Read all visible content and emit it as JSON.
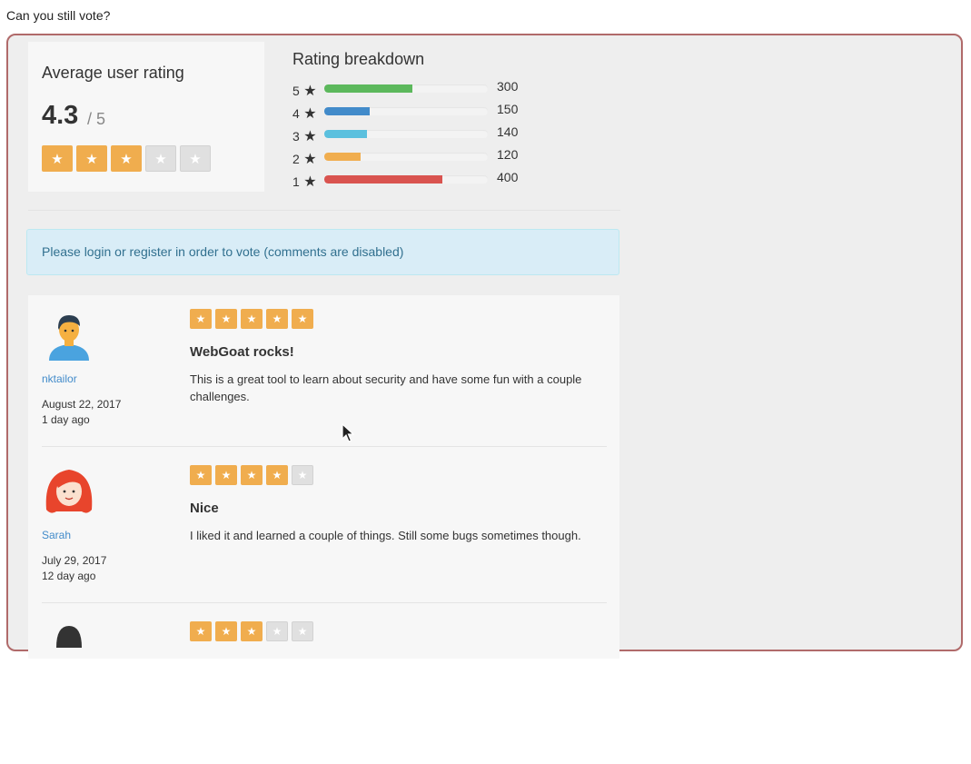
{
  "page": {
    "heading": "Can you still vote?"
  },
  "average": {
    "title": "Average user rating",
    "score": "4.3",
    "out_of": "/ 5",
    "stars_filled": 3,
    "stars_total": 5
  },
  "breakdown": {
    "title": "Rating breakdown",
    "rows": [
      {
        "stars": "5",
        "count": "300",
        "fraction": 0.54,
        "color": "#5cb85c"
      },
      {
        "stars": "4",
        "count": "150",
        "fraction": 0.28,
        "color": "#428bca"
      },
      {
        "stars": "3",
        "count": "140",
        "fraction": 0.26,
        "color": "#5bc0de"
      },
      {
        "stars": "2",
        "count": "120",
        "fraction": 0.22,
        "color": "#f0ad4e"
      },
      {
        "stars": "1",
        "count": "400",
        "fraction": 0.72,
        "color": "#d9534f"
      }
    ]
  },
  "alert": {
    "text": "Please login or register in order to vote (comments are disabled)"
  },
  "reviews": [
    {
      "user": "nktailor",
      "date": "August 22, 2017",
      "ago": "1 day ago",
      "stars": 5,
      "title": "WebGoat rocks!",
      "text": "This is a great tool to learn about security and have some fun with a couple challenges.",
      "avatar": "male-avatar"
    },
    {
      "user": "Sarah",
      "date": "July 29, 2017",
      "ago": "12 day ago",
      "stars": 4,
      "title": "Nice",
      "text": "I liked it and learned a couple of things. Still some bugs sometimes though.",
      "avatar": "female-avatar"
    },
    {
      "stars": 3,
      "avatar": "dark-avatar"
    }
  ],
  "colors": {
    "star_on": "#f0ad4e",
    "star_off": "#e0e0e0",
    "panel_border": "#b06a6a",
    "link": "#428bca"
  }
}
